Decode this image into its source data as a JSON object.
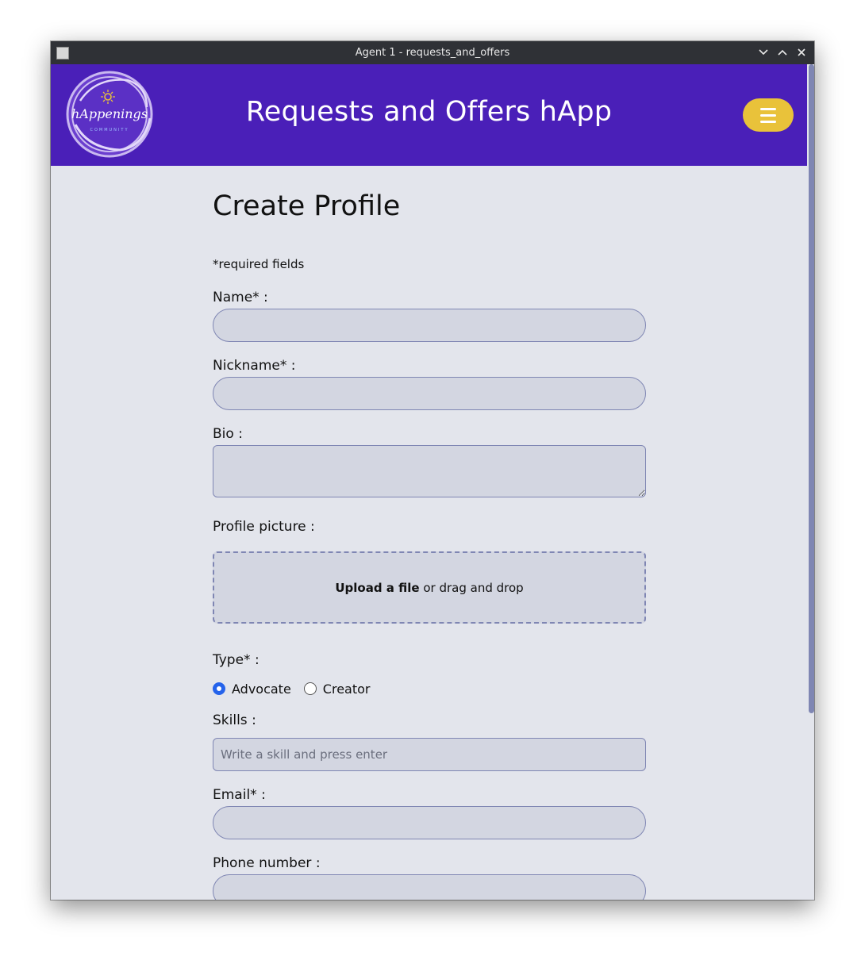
{
  "window": {
    "title": "Agent 1 - requests_and_offers"
  },
  "navbar": {
    "logo_text": "hAppenings",
    "logo_subtext": "COMMUNITY",
    "app_title": "Requests and Offers hApp",
    "menu_icon": "hamburger-icon"
  },
  "page": {
    "title": "Create Profile",
    "required_note": "*required fields"
  },
  "form": {
    "name_label": "Name* :",
    "nickname_label": "Nickname* :",
    "bio_label": "Bio :",
    "picture_label": "Profile picture :",
    "upload_link": "Upload a file",
    "upload_rest": "or drag and drop",
    "type_label": "Type* :",
    "type_options": [
      {
        "label": "Advocate",
        "checked": true
      },
      {
        "label": "Creator",
        "checked": false
      }
    ],
    "skills_label": "Skills :",
    "skills_placeholder": "Write a skill and press enter",
    "email_label": "Email* :",
    "phone_label": "Phone number :"
  },
  "colors": {
    "navbar": "#4a1fb8",
    "menu_button": "#e9c23a",
    "page_bg": "#e3e5ec",
    "input_bg": "#d3d6e1",
    "input_border": "#7f86b3",
    "radio_checked": "#2563eb"
  }
}
